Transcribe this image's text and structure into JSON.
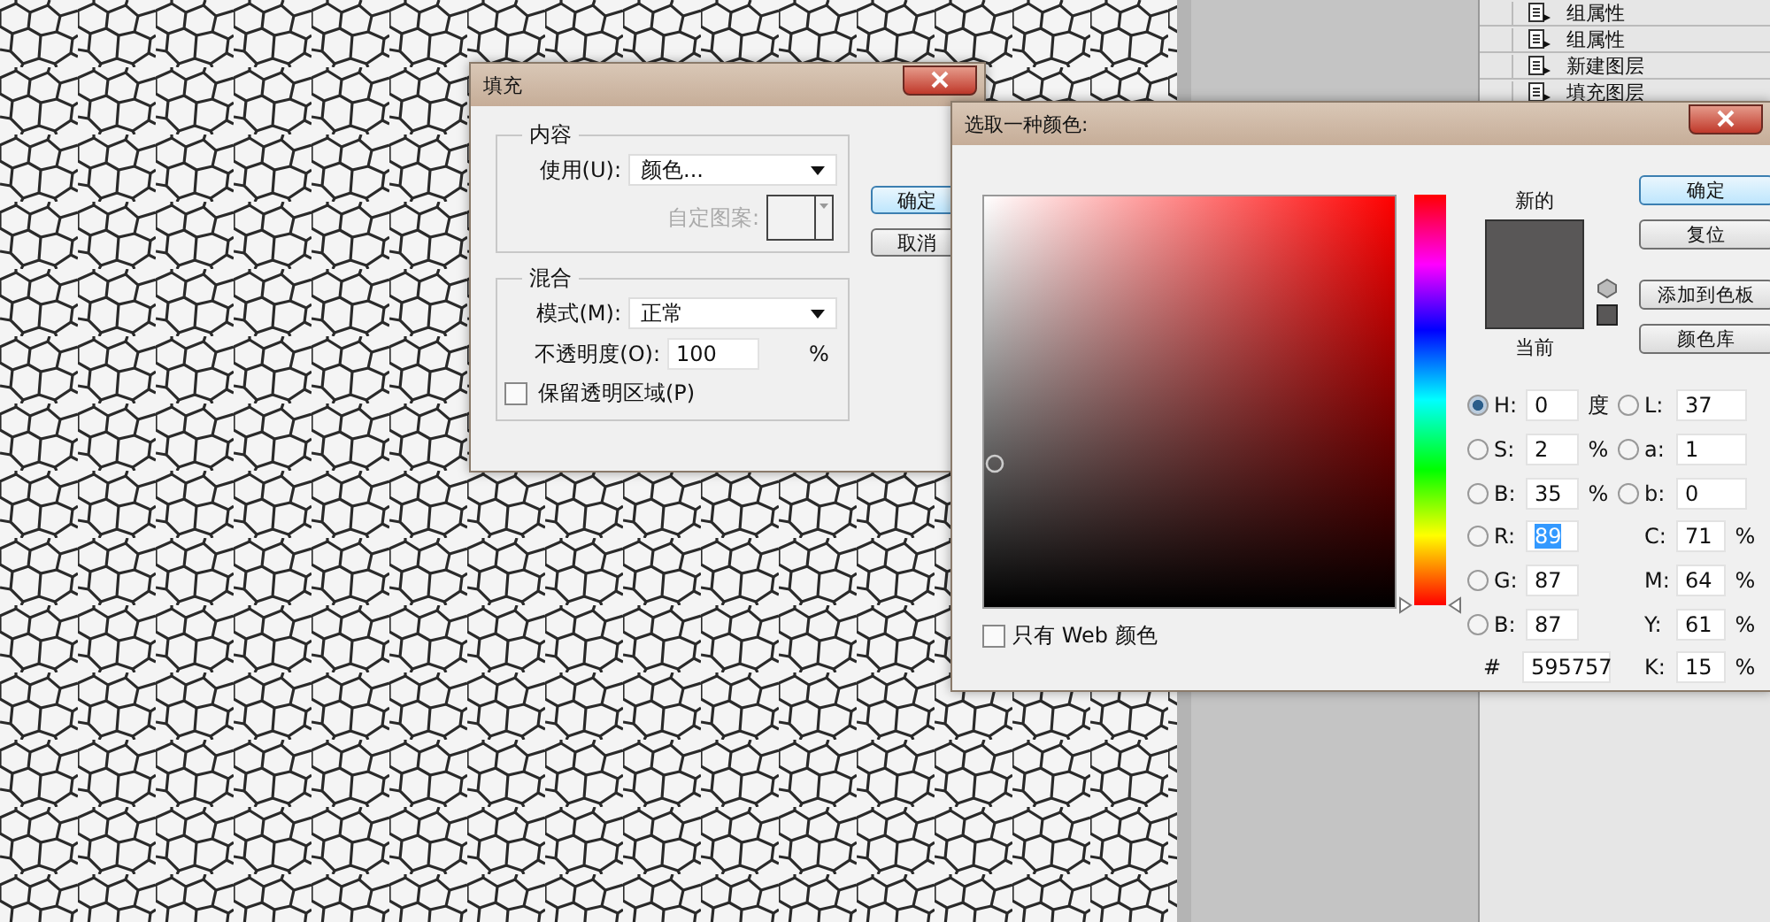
{
  "history_panel": {
    "items": [
      {
        "label": "组属性"
      },
      {
        "label": "组属性"
      },
      {
        "label": "新建图层"
      },
      {
        "label": "填充图层"
      }
    ]
  },
  "fill_dialog": {
    "title": "填充",
    "content_group": {
      "legend": "内容",
      "use_label": "使用(U):",
      "use_value": "颜色...",
      "pattern_label": "自定图案:",
      "pattern_disabled": true
    },
    "blend_group": {
      "legend": "混合",
      "mode_label": "模式(M):",
      "mode_value": "正常",
      "opacity_label": "不透明度(O):",
      "opacity_value": "100",
      "opacity_unit": "%",
      "preserve_label": "保留透明区域(P)",
      "preserve_checked": false
    },
    "buttons": [
      {
        "label": "确定",
        "selected": true
      },
      {
        "label": "取消",
        "selected": false
      }
    ]
  },
  "color_picker": {
    "title": "选取一种颜色:",
    "hue": {
      "level": 0
    },
    "new_label": "新的",
    "current_label": "当前",
    "buttons": [
      {
        "label": "确定",
        "selected": true
      },
      {
        "label": "复位",
        "selected": false
      },
      {
        "label": "添加到色板",
        "selected": false
      },
      {
        "label": "颜色库",
        "selected": false
      }
    ],
    "left_fields": [
      {
        "label": "H:",
        "value": "0",
        "unit": "度",
        "selected": true,
        "highlighted": false
      },
      {
        "label": "S:",
        "value": "2",
        "unit": "%",
        "selected": false,
        "highlighted": false
      },
      {
        "label": "B:",
        "value": "35",
        "unit": "%",
        "selected": false,
        "highlighted": false
      },
      {
        "label": "R:",
        "value": "89",
        "selected": false,
        "highlighted": true
      },
      {
        "label": "G:",
        "value": "87",
        "selected": false,
        "highlighted": false
      },
      {
        "label": "B:",
        "value": "87",
        "selected": false,
        "highlighted": false
      }
    ],
    "hex_label": "#",
    "hex_value": "595757",
    "right_fields": [
      {
        "kind": "radio",
        "label": "L:",
        "value": "37",
        "selected": false
      },
      {
        "kind": "radio",
        "label": "a:",
        "value": "1",
        "selected": false
      },
      {
        "kind": "radio",
        "label": "b:",
        "value": "0",
        "selected": false
      },
      {
        "kind": "plain",
        "label": "C:",
        "value": "71",
        "unit": "%"
      },
      {
        "kind": "plain",
        "label": "M:",
        "value": "64",
        "unit": "%"
      },
      {
        "kind": "plain",
        "label": "Y:",
        "value": "61",
        "unit": "%"
      },
      {
        "kind": "plain",
        "label": "K:",
        "value": "15",
        "unit": "%"
      }
    ],
    "web_only": {
      "label": "只有 Web 颜色",
      "checked": false
    }
  }
}
